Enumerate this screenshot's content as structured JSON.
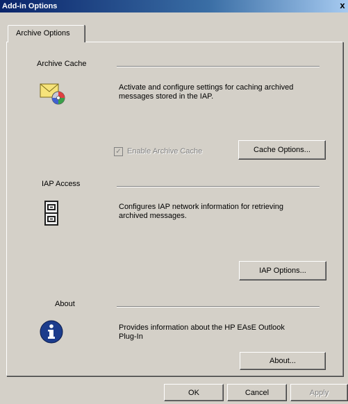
{
  "window": {
    "title": "Add-in Options",
    "close_glyph": "x"
  },
  "tab": {
    "label": "Archive Options"
  },
  "archive_cache": {
    "title": "Archive Cache",
    "icon": "envelope-disc-icon",
    "description_line1": "Activate and configure settings for caching archived",
    "description_line2": "messages stored in the IAP.",
    "checkbox_label": "Enable Archive Cache",
    "checkbox_checked": true,
    "checkbox_enabled": false,
    "button_label": "Cache Options..."
  },
  "iap_access": {
    "title": "IAP Access",
    "icon": "filing-cabinet-icon",
    "description_line1": "Configures IAP network information for retrieving",
    "description_line2": "archived messages.",
    "button_label": "IAP Options..."
  },
  "about": {
    "title": "About",
    "icon": "info-icon",
    "description_line1": "Provides information about the HP EAsE Outlook",
    "description_line2": "Plug-In",
    "button_label": "About..."
  },
  "footer": {
    "ok_label": "OK",
    "cancel_label": "Cancel",
    "apply_label": "Apply",
    "apply_enabled": false
  },
  "colors": {
    "dialog_bg": "#d4d0c8",
    "titlebar_start": "#0a246a",
    "titlebar_end": "#a6caf0",
    "info_icon_blue": "#1c3c8c"
  }
}
